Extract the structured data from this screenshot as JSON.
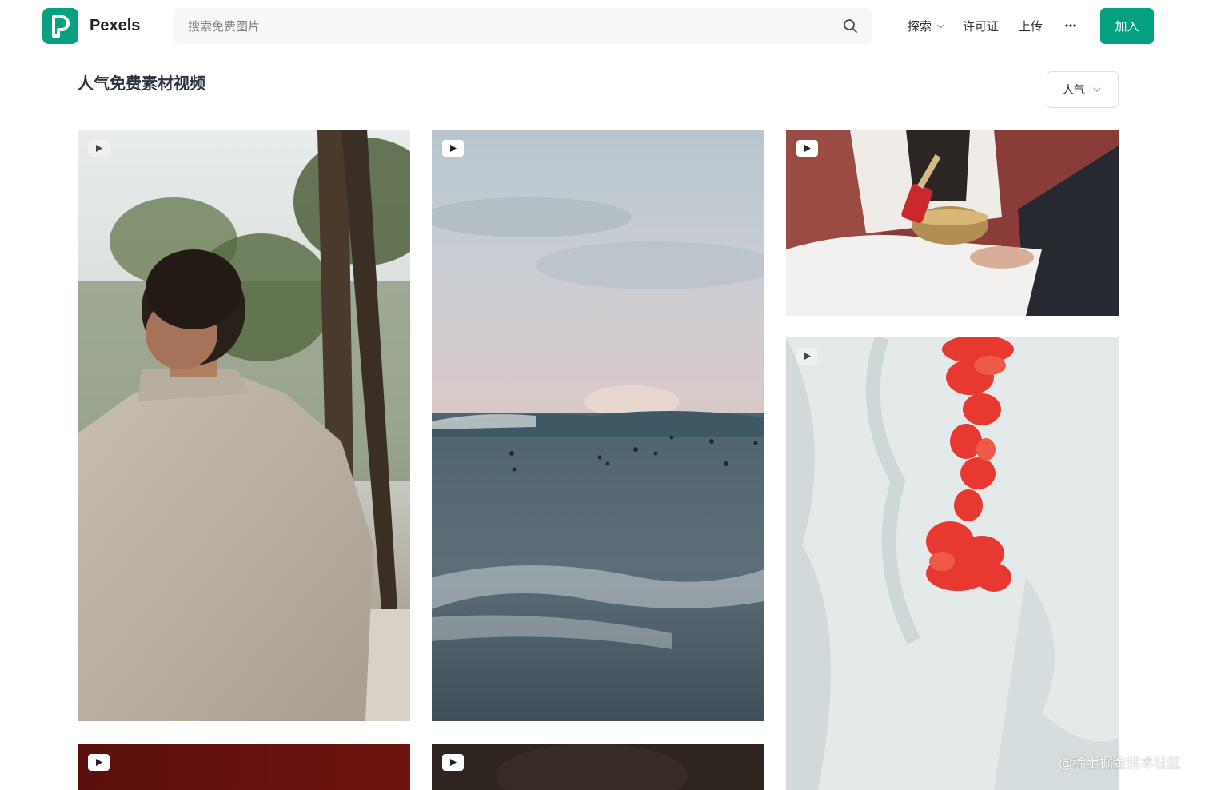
{
  "brand": {
    "name": "Pexels",
    "logo_letter": "P",
    "color": "#05a081"
  },
  "search": {
    "placeholder": "搜索免费图片",
    "value": ""
  },
  "nav": {
    "explore": "探索",
    "license": "许可证",
    "upload": "上传",
    "join": "加入"
  },
  "page": {
    "title": "人气免费素材视频"
  },
  "sort": {
    "selected": "人气"
  },
  "videos": [
    {
      "name": "man-palm-trees",
      "icon": "play-icon"
    },
    {
      "name": "ocean-surfers",
      "icon": "play-icon"
    },
    {
      "name": "singing-bowl",
      "icon": "play-icon"
    },
    {
      "name": "red-ink-water",
      "icon": "play-icon"
    },
    {
      "name": "dark-red",
      "icon": "play-icon"
    },
    {
      "name": "dark-brown",
      "icon": "play-icon"
    }
  ],
  "watermark": "@稀土掘金技术社区"
}
